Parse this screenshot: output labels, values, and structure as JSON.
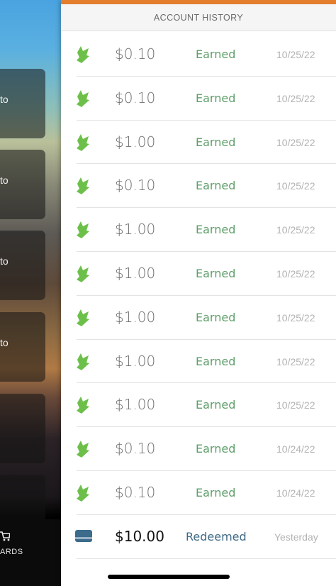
{
  "background_app": {
    "card_labels": [
      "to",
      "to",
      "to",
      "to",
      "",
      ""
    ],
    "tab_label": "ARDS"
  },
  "drawer": {
    "title": "ACCOUNT HISTORY",
    "rows": [
      {
        "icon": "leaf-icon",
        "amount": "$0.10",
        "type": "Earned",
        "date": "10/25/22"
      },
      {
        "icon": "leaf-icon",
        "amount": "$0.10",
        "type": "Earned",
        "date": "10/25/22"
      },
      {
        "icon": "leaf-icon",
        "amount": "$1.00",
        "type": "Earned",
        "date": "10/25/22"
      },
      {
        "icon": "leaf-icon",
        "amount": "$0.10",
        "type": "Earned",
        "date": "10/25/22"
      },
      {
        "icon": "leaf-icon",
        "amount": "$1.00",
        "type": "Earned",
        "date": "10/25/22"
      },
      {
        "icon": "leaf-icon",
        "amount": "$1.00",
        "type": "Earned",
        "date": "10/25/22"
      },
      {
        "icon": "leaf-icon",
        "amount": "$1.00",
        "type": "Earned",
        "date": "10/25/22"
      },
      {
        "icon": "leaf-icon",
        "amount": "$1.00",
        "type": "Earned",
        "date": "10/25/22"
      },
      {
        "icon": "leaf-icon",
        "amount": "$1.00",
        "type": "Earned",
        "date": "10/25/22"
      },
      {
        "icon": "leaf-icon",
        "amount": "$0.10",
        "type": "Earned",
        "date": "10/24/22"
      },
      {
        "icon": "leaf-icon",
        "amount": "$0.10",
        "type": "Earned",
        "date": "10/24/22"
      },
      {
        "icon": "card-icon",
        "amount": "$10.00",
        "type": "Redeemed",
        "date": "Yesterday"
      }
    ]
  },
  "colors": {
    "accent": "#e47d2c",
    "earned": "#5e9e6a",
    "redeemed": "#3f6a86",
    "leaf": "#6cc04a"
  }
}
